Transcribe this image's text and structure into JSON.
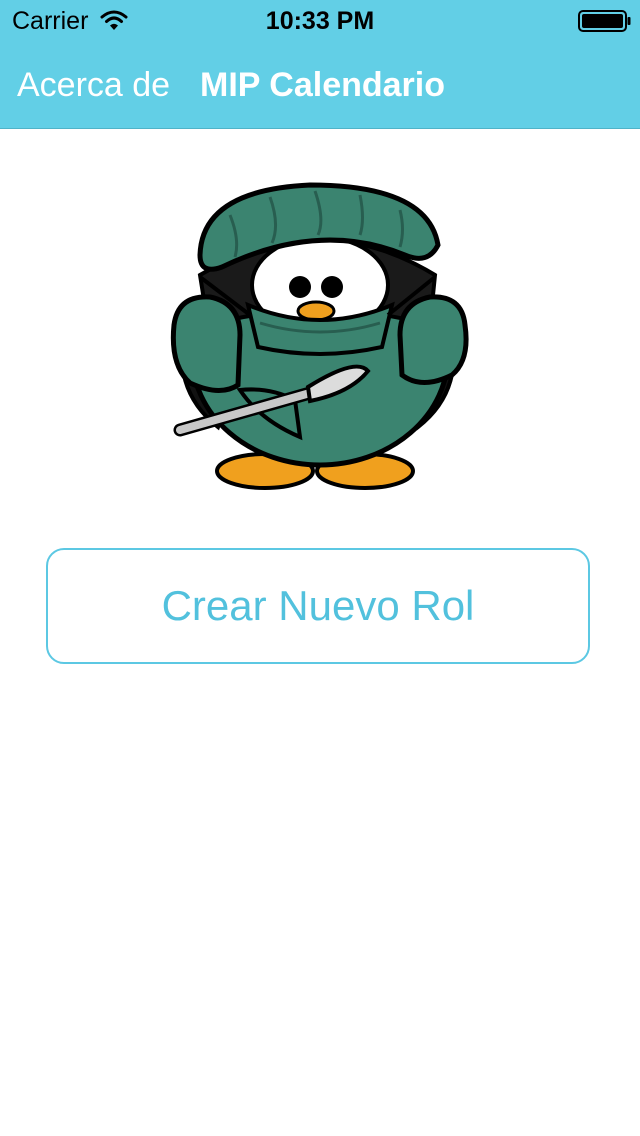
{
  "status_bar": {
    "carrier": "Carrier",
    "time": "10:33 PM",
    "wifi_icon": "wifi-icon",
    "battery_icon": "battery-icon"
  },
  "nav_bar": {
    "back_label": "Acerca de",
    "title": "MIP Calendario",
    "background_color": "#62cfe6"
  },
  "main": {
    "mascot_icon": "penguin-surgeon-icon",
    "create_button_label": "Crear Nuevo Rol",
    "accent_color": "#52c1dd"
  }
}
